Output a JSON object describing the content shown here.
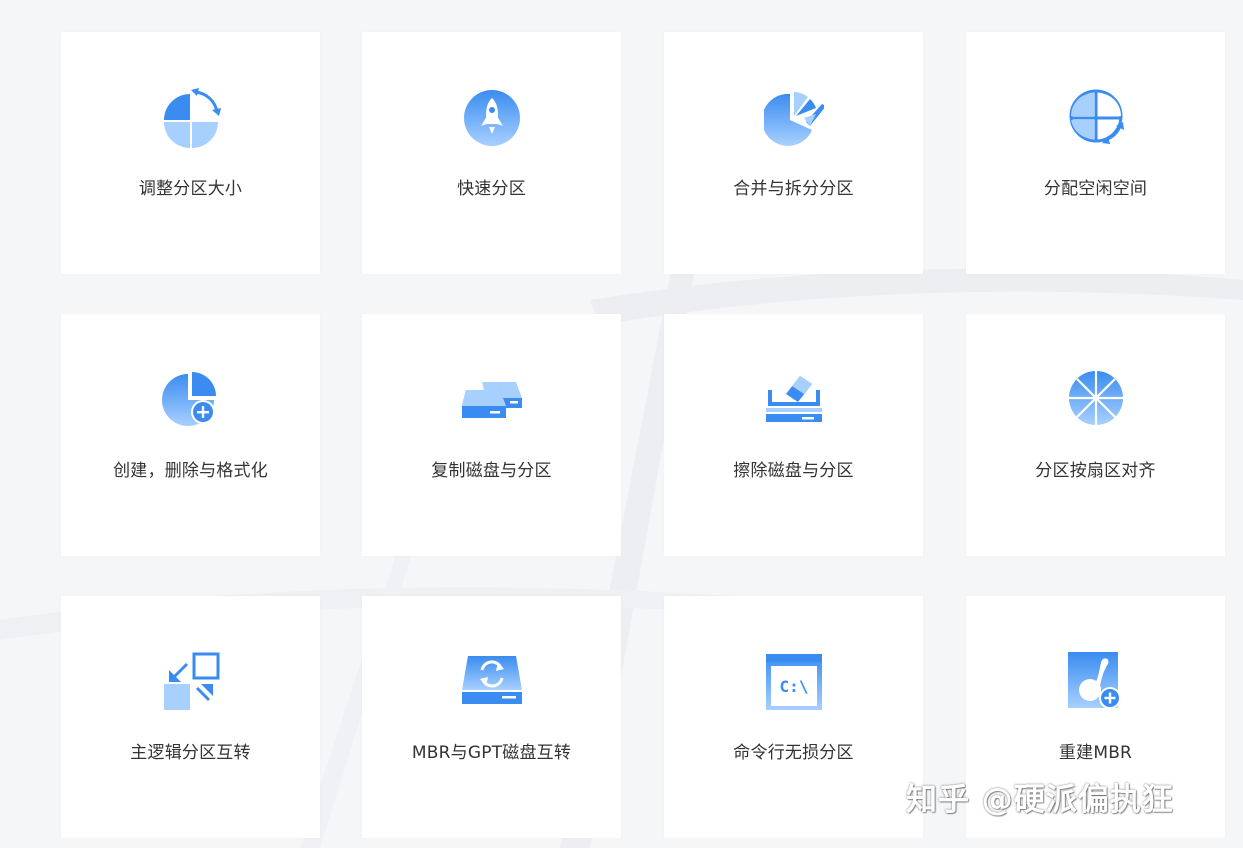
{
  "colors": {
    "icon_light": "#a8d0ff",
    "icon_dark": "#3a8cf0",
    "card": "#ffffff",
    "page": "#f5f6f8"
  },
  "features": [
    {
      "label": "调整分区大小",
      "icon": "pie-resize-icon"
    },
    {
      "label": "快速分区",
      "icon": "rocket-icon"
    },
    {
      "label": "合并与拆分分区",
      "icon": "pie-split-icon"
    },
    {
      "label": "分配空闲空间",
      "icon": "pie-allocate-icon"
    },
    {
      "label": "创建，删除与格式化",
      "icon": "pie-add-icon"
    },
    {
      "label": "复制磁盘与分区",
      "icon": "disk-copy-icon"
    },
    {
      "label": "擦除磁盘与分区",
      "icon": "disk-wipe-icon"
    },
    {
      "label": "分区按扇区对齐",
      "icon": "sector-align-icon"
    },
    {
      "label": "主逻辑分区互转",
      "icon": "partition-convert-icon"
    },
    {
      "label": "MBR与GPT磁盘互转",
      "icon": "disk-convert-icon"
    },
    {
      "label": "命令行无损分区",
      "icon": "command-line-icon"
    },
    {
      "label": "重建MBR",
      "icon": "rebuild-mbr-icon"
    }
  ],
  "command_icon_text": "C:\\",
  "watermark": "知乎 @硬派偏执狂"
}
